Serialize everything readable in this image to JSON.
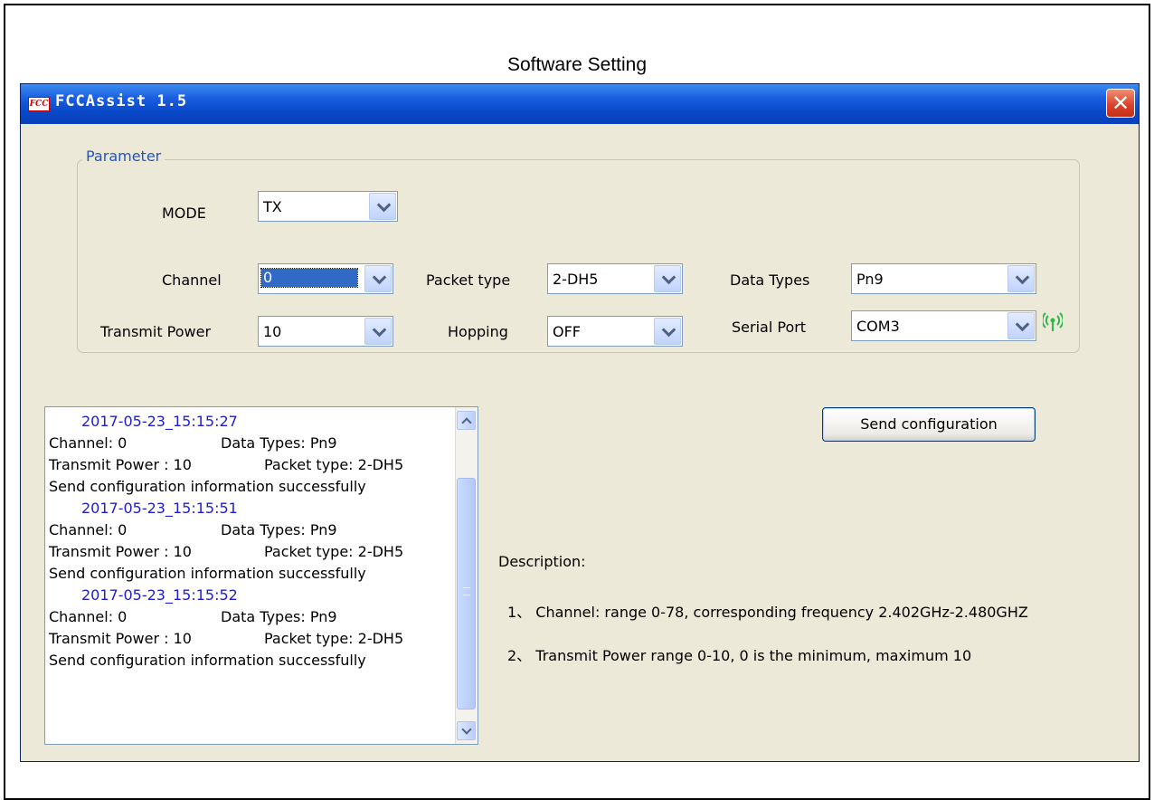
{
  "caption": "Software Setting",
  "window": {
    "title": "FCCAssist 1.5",
    "icon_text": "FCC",
    "close_glyph": "✕"
  },
  "parameter": {
    "group_title": "Parameter",
    "mode": {
      "label": "MODE",
      "value": "TX"
    },
    "channel": {
      "label": "Channel",
      "value": "0"
    },
    "packet_type": {
      "label": "Packet type",
      "value": "2-DH5"
    },
    "data_types": {
      "label": "Data Types",
      "value": "Pn9"
    },
    "transmit_power": {
      "label": "Transmit Power",
      "value": "10"
    },
    "hopping": {
      "label": "Hopping",
      "value": "OFF"
    },
    "serial_port": {
      "label": "Serial Port",
      "value": "COM3"
    },
    "status_icon": "antenna-signal-icon",
    "status_color": "#2db84a"
  },
  "log": {
    "entries": [
      {
        "timestamp": "2017-05-23_15:15:27",
        "line1_a": "Channel: 0",
        "line1_b": "Data Types: Pn9",
        "line2_a": "Transmit Power : 10",
        "line2_b": "Packet type: 2-DH5",
        "line3": "Send configuration information successfully"
      },
      {
        "timestamp": "2017-05-23_15:15:51",
        "line1_a": "Channel: 0",
        "line1_b": "Data Types: Pn9",
        "line2_a": "Transmit Power : 10",
        "line2_b": "Packet type: 2-DH5",
        "line3": "Send configuration information successfully"
      },
      {
        "timestamp": "2017-05-23_15:15:52",
        "line1_a": "Channel: 0",
        "line1_b": "Data Types: Pn9",
        "line2_a": "Transmit Power : 10",
        "line2_b": "Packet type: 2-DH5",
        "line3": "Send configuration information successfully"
      }
    ]
  },
  "send_button": "Send configuration",
  "description": {
    "heading": "Description:",
    "item1": "1、 Channel: range 0-78, corresponding frequency 2.402GHz-2.480GHZ",
    "item2": "2、 Transmit Power  range 0-10, 0 is the minimum, maximum 10"
  },
  "colors": {
    "titlebar": "#0a46c8",
    "window_bg": "#ece9d8",
    "group_title": "#2155c8",
    "timestamp": "#2020c8"
  }
}
